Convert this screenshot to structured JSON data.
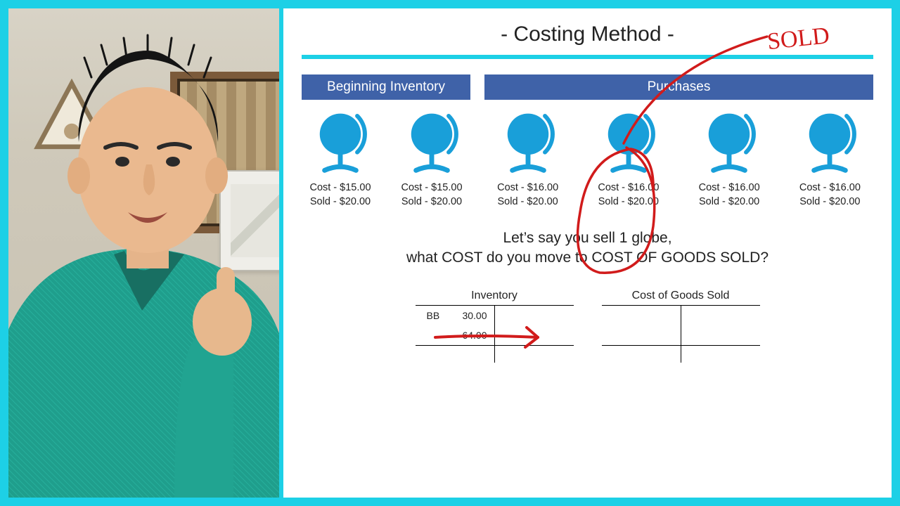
{
  "title": "- Costing Method -",
  "headers": {
    "beginning": "Beginning Inventory",
    "purchases": "Purchases"
  },
  "items": {
    "beginning": [
      {
        "cost": "Cost - $15.00",
        "sold": "Sold - $20.00"
      },
      {
        "cost": "Cost - $15.00",
        "sold": "Sold - $20.00"
      }
    ],
    "purchases": [
      {
        "cost": "Cost - $16.00",
        "sold": "Sold - $20.00"
      },
      {
        "cost": "Cost - $16.00",
        "sold": "Sold - $20.00"
      },
      {
        "cost": "Cost - $16.00",
        "sold": "Sold - $20.00"
      },
      {
        "cost": "Cost - $16.00",
        "sold": "Sold - $20.00"
      }
    ]
  },
  "question": {
    "line1": "Let’s say you sell 1 globe,",
    "line2": "what COST do you move to COST OF GOODS SOLD?"
  },
  "taccounts": {
    "inventory": {
      "title": "Inventory",
      "rows": [
        {
          "label": "BB",
          "left": "30.00",
          "right": ""
        },
        {
          "label": "",
          "left": "64.00",
          "right": ""
        }
      ]
    },
    "cogs": {
      "title": "Cost of Goods Sold",
      "rows": [
        {
          "left": "",
          "right": ""
        }
      ]
    }
  },
  "annotations": {
    "sold_label": "SOLD"
  },
  "colors": {
    "frame": "#1dd0e6",
    "header": "#3f62a8",
    "globe": "#199fd9",
    "ink": "#d11b1b"
  }
}
